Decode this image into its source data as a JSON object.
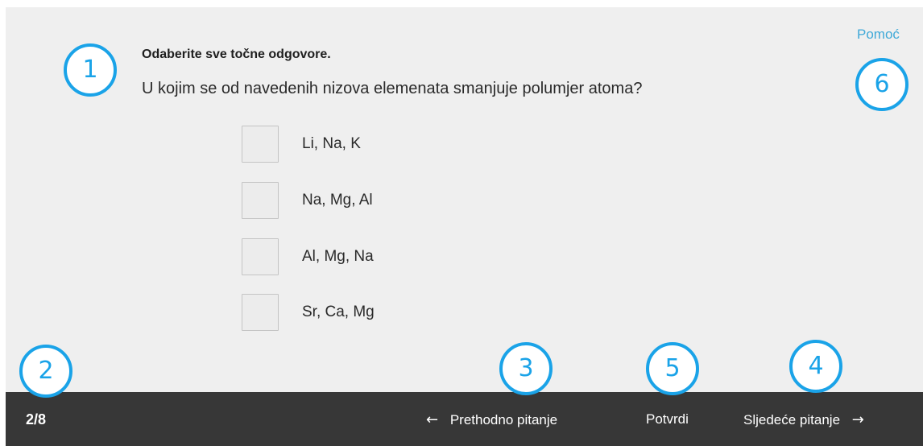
{
  "help_link": "Pomoć",
  "question": {
    "instruction": "Odaberite sve točne odgovore.",
    "text": "U kojim se od navedenih nizova elemenata smanjuje polumjer atoma?"
  },
  "options": [
    {
      "label": "Li, Na, K",
      "checked": false
    },
    {
      "label": "Na, Mg, Al",
      "checked": false
    },
    {
      "label": "Al, Mg, Na",
      "checked": false
    },
    {
      "label": "Sr, Ca, Mg",
      "checked": false
    }
  ],
  "footer": {
    "progress": "2/8",
    "prev_label": "Prethodno pitanje",
    "prev_arrow": "←",
    "confirm_label": "Potvrdi",
    "next_label": "Sljedeće pitanje",
    "next_arrow": "→"
  },
  "badges": [
    "1",
    "2",
    "3",
    "4",
    "5",
    "6"
  ],
  "colors": {
    "badge": "#1aa3e8",
    "help_link": "#3fa9d8",
    "bottom_bar": "#373737",
    "content_bg": "#efefef"
  }
}
